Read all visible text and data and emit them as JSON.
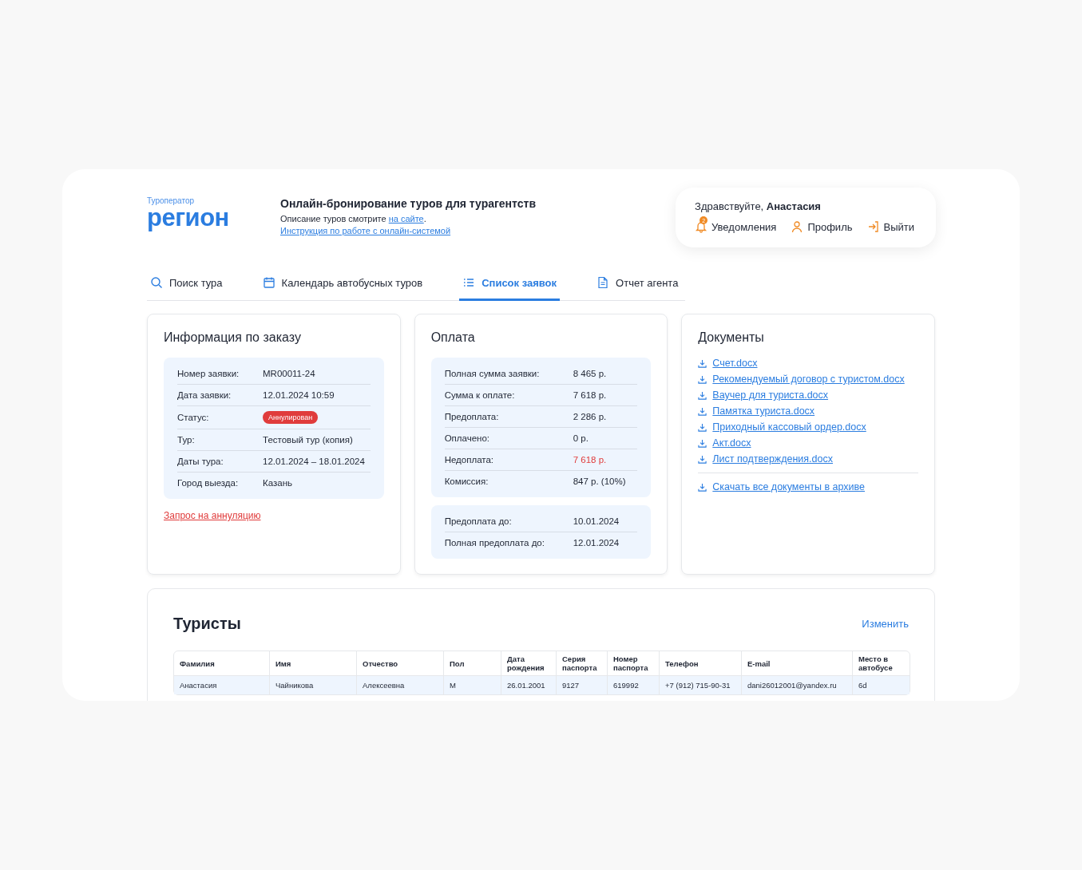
{
  "header": {
    "logo_caption": "Туроператор",
    "logo": "регион",
    "title": "Онлайн-бронирование туров для турагентств",
    "subtitle": "Описание туров смотрите",
    "subtitle_link": "на сайте",
    "subtitle_end": ".",
    "instruction_link": "Инструкция по работе с онлайн-системой"
  },
  "user": {
    "greeting": "Здравствуйте,",
    "name": "Анастасия",
    "notifications": {
      "label": "Уведомления",
      "count": "2"
    },
    "profile": "Профиль",
    "logout": "Выйти"
  },
  "tabs": [
    {
      "label": "Поиск тура",
      "kind": "search",
      "selected": false
    },
    {
      "label": "Календарь автобусных туров",
      "kind": "calendar",
      "selected": false
    },
    {
      "label": "Список заявок",
      "kind": "list",
      "selected": true
    },
    {
      "label": "Отчет агента",
      "kind": "doc",
      "selected": false
    }
  ],
  "order": {
    "title": "Информация по заказу",
    "rows": [
      {
        "label": "Номер заявки:",
        "value": "MR00011-24",
        "kind": "text"
      },
      {
        "label": "Дата заявки:",
        "value": "12.01.2024 10:59",
        "kind": "text"
      },
      {
        "label": "Статус:",
        "value": "Аннулирован",
        "kind": "badge",
        "color": "#e03c3c"
      },
      {
        "label": "Тур:",
        "value": "Тестовый тур (копия)",
        "kind": "text"
      },
      {
        "label": "Даты тура:",
        "value": "12.01.2024 – 18.01.2024",
        "kind": "text"
      },
      {
        "label": "Город выезда:",
        "value": "Казань",
        "kind": "text"
      }
    ],
    "cancel_link": "Запрос на аннуляцию"
  },
  "payment": {
    "title": "Оплата",
    "rows": [
      {
        "label": "Полная сумма заявки:",
        "value": "8 465 р.",
        "alert": false
      },
      {
        "label": "Сумма к оплате:",
        "value": "7 618 р.",
        "alert": false
      },
      {
        "label": "Предоплата:",
        "value": "2 286 р.",
        "alert": false
      },
      {
        "label": "Оплачено:",
        "value": "0 р.",
        "alert": false
      },
      {
        "label": "Недоплата:",
        "value": "7 618 р.",
        "alert": true
      },
      {
        "label": "Комиссия:",
        "value": "847 р. (10%)",
        "alert": false
      }
    ],
    "deadlines": [
      {
        "label": "Предоплата до:",
        "value": "10.01.2024"
      },
      {
        "label": "Полная предоплата до:",
        "value": "12.01.2024"
      }
    ]
  },
  "documents": {
    "title": "Документы",
    "files": [
      "Счет.docx",
      "Рекомендуемый договор с туристом.docx",
      "Ваучер для туриста.docx",
      "Памятка туриста.docx",
      "Приходный кассовый ордер.docx",
      "Акт.docx",
      "Лист подтверждения.docx"
    ],
    "download_all": "Скачать все документы в архиве"
  },
  "tourists": {
    "title": "Туристы",
    "edit": "Изменить",
    "columns": [
      "Фамилия",
      "Имя",
      "Отчество",
      "Пол",
      "Дата рождения",
      "Серия паспорта",
      "Номер паспорта",
      "Телефон",
      "E-mail",
      "Место в автобусе"
    ],
    "rows": [
      [
        "Анастасия",
        "Чайникова",
        "Алексеевна",
        "М",
        "26.01.2001",
        "9127",
        "619992",
        "+7 (912) 715-90-31",
        "dani26012001@yandex.ru",
        "6d"
      ]
    ]
  }
}
